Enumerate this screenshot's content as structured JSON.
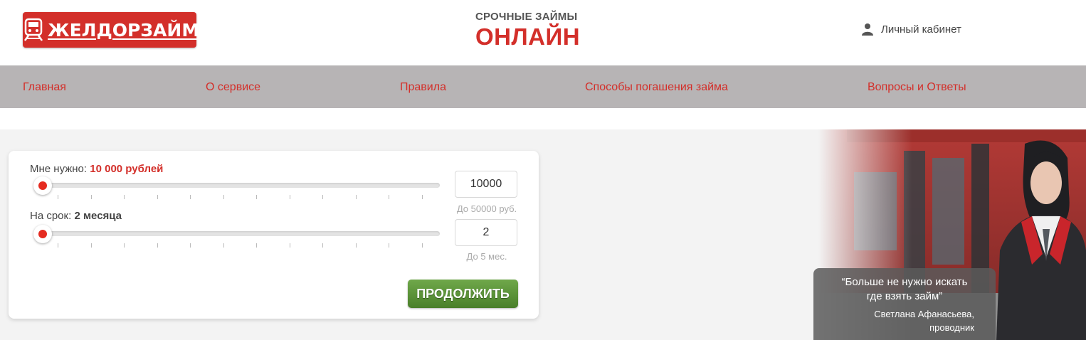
{
  "header": {
    "logo_text": "ЖЕЛДОРЗАЙМ",
    "tagline_top": "СРОЧНЫЕ ЗАЙМЫ",
    "tagline_bottom": "ОНЛАЙН",
    "cabinet_label": "Личный кабинет",
    "cabinet_icon": "user-icon"
  },
  "nav": {
    "items": [
      {
        "label": "Главная"
      },
      {
        "label": "О сервисе"
      },
      {
        "label": "Правила"
      },
      {
        "label": "Способы погашения займа"
      },
      {
        "label": "Вопросы и Ответы"
      }
    ]
  },
  "calculator": {
    "amount": {
      "label": "Мне нужно:",
      "value_text": "10 000 рублей",
      "input_value": "10000",
      "hint": "До 50000 руб.",
      "level": 0
    },
    "term": {
      "label": "На срок:",
      "value_text": "2 месяца",
      "input_value": "2",
      "hint": "До 5 мес.",
      "level": 0
    },
    "continue_label": "ПРОДОЛЖИТЬ"
  },
  "quote": {
    "text_line1": "“Больше не нужно искать",
    "text_line2": "где взять займ”",
    "author_line1": "Светлана Афанасьева,",
    "author_line2": "проводник"
  },
  "colors": {
    "brand_red": "#d32f2a",
    "nav_bg": "#b7b4b5",
    "button_green": "#5a9338"
  }
}
